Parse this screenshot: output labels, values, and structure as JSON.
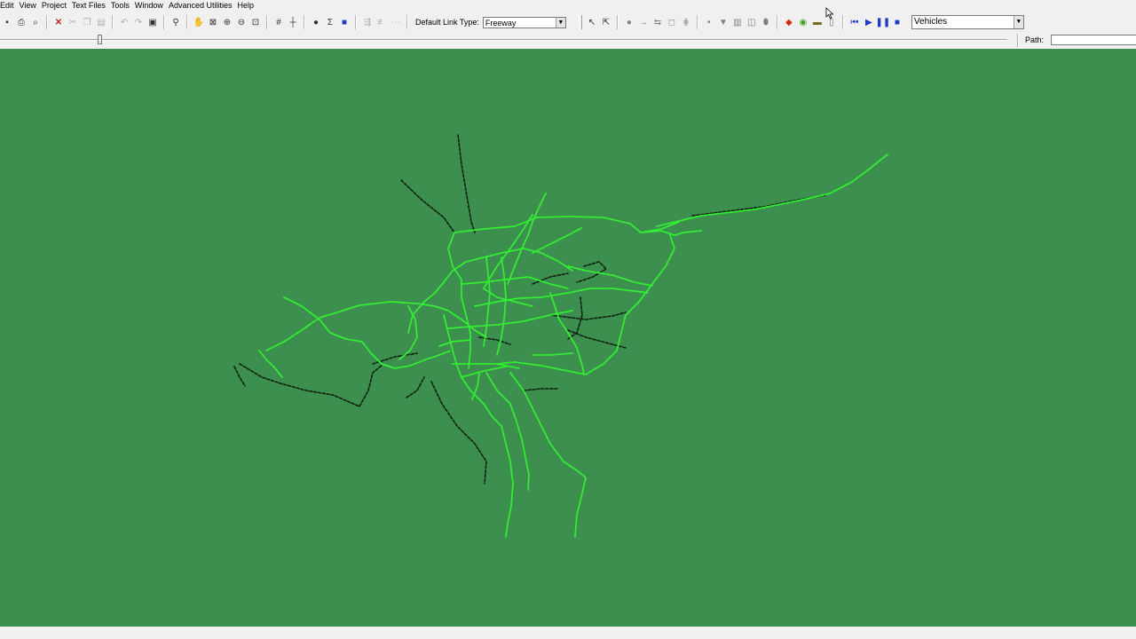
{
  "menu": [
    "Edit",
    "View",
    "Project",
    "Text Files",
    "Tools",
    "Window",
    "Advanced Utilities",
    "Help"
  ],
  "toolbar": {
    "link_type_label": "Default Link Type:",
    "link_type_value": "Freeway",
    "display_mode_value": "Vehicles",
    "icons_file": [
      "new-file-icon",
      "print-icon",
      "print-preview-icon"
    ],
    "icons_edit": [
      "delete-icon",
      "cut-icon",
      "copy-icon",
      "paste-icon",
      "undo-icon",
      "redo-icon",
      "save-icon"
    ],
    "icons_view": [
      "find-icon",
      "pan-icon",
      "zoom-window-icon",
      "zoom-in-icon",
      "zoom-out-icon",
      "zoom-extents-icon"
    ],
    "icons_grid": [
      "grid-icon",
      "snap-icon"
    ],
    "icons_info": [
      "info-icon",
      "summary-icon",
      "bus-icon"
    ],
    "icons_lanes": [
      "lane-add-icon",
      "lane-remove-icon",
      "lane-misc-icon"
    ],
    "icons_draw": [
      "select-arrow-icon",
      "select-multi-icon",
      "node-icon",
      "link-arrow-icon",
      "two-way-link-icon",
      "polygon-icon",
      "align-icon",
      "point-icon",
      "filter-icon",
      "column-icon",
      "column-2-icon",
      "marker-icon"
    ],
    "icons_sim": [
      "run-red-icon",
      "run-green-icon",
      "vehicle-icon",
      "chart-icon"
    ],
    "playback": [
      "rewind-icon",
      "play-icon",
      "pause-icon",
      "stop-icon"
    ]
  },
  "path": {
    "label": "Path:",
    "value": ""
  },
  "colors": {
    "canvas_bg": "#3d8f4f",
    "network_link": "#33ee33",
    "network_dark": "#102010"
  }
}
